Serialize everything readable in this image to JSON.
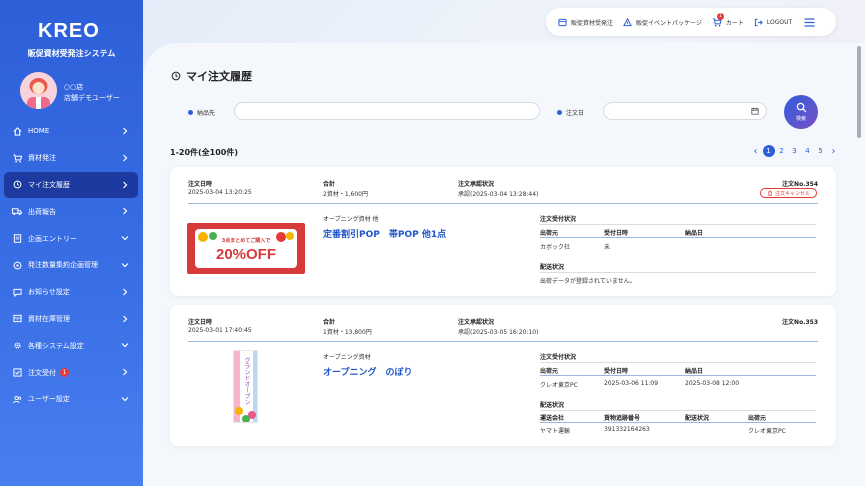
{
  "brand": {
    "logo": "KREO",
    "system_name": "販促資材受発注システム"
  },
  "user": {
    "line1": "○○店",
    "line2": "店舗デモユーザー"
  },
  "nav": [
    {
      "label": "HOME",
      "icon": "home-icon",
      "chev": "right"
    },
    {
      "label": "資材発注",
      "icon": "cart-icon",
      "chev": "right"
    },
    {
      "label": "マイ注文履歴",
      "icon": "history-icon",
      "chev": "right",
      "active": true
    },
    {
      "label": "出荷報告",
      "icon": "truck-icon",
      "chev": "right"
    },
    {
      "label": "企画エントリー",
      "icon": "document-icon",
      "chev": "down"
    },
    {
      "label": "発注数量集約企画管理",
      "icon": "settings-icon",
      "chev": "down"
    },
    {
      "label": "お知らせ設定",
      "icon": "message-icon",
      "chev": "right"
    },
    {
      "label": "資材在庫管理",
      "icon": "inventory-icon",
      "chev": "right"
    },
    {
      "label": "各種システム設定",
      "icon": "gear-icon",
      "chev": "down"
    },
    {
      "label": "注文受付",
      "icon": "check-icon",
      "chev": "right",
      "badge": "1"
    },
    {
      "label": "ユーザー設定",
      "icon": "users-icon",
      "chev": "down"
    }
  ],
  "topbar": {
    "material_order": "販促資材受発注",
    "event_package": "販促イベントパッケージ",
    "cart": "カート",
    "cart_badge": "1",
    "logout": "LOGOUT"
  },
  "page_title": "マイ注文履歴",
  "filters": {
    "delivery_label": "納品先",
    "delivery_value": "",
    "order_date_label": "注文日",
    "order_date_value": "",
    "search_label": "検索"
  },
  "result_count": "1-20件(全100件)",
  "pagination": {
    "prev": "‹",
    "pages": [
      "1",
      "2",
      "3",
      "4",
      "5"
    ],
    "current": "1",
    "next": "›"
  },
  "orders": [
    {
      "hdr_date": "注文日時",
      "date": "2025-03-04 13:20:25",
      "hdr_total": "合計",
      "total": "2資材・1,600円",
      "hdr_approval": "注文承認状況",
      "approval": "承認(2025-03-04 13:28:44)",
      "order_no": "注文No.354",
      "cancel_label": "注文キャンセル",
      "category": "オープニング資材 他",
      "product": "定番割引POP　帯POP 他1点",
      "banner_line1": "3点まとめてご購入で",
      "banner_line2": "20%OFF",
      "accept_title": "注文受付状況",
      "accept_cols": [
        "出荷元",
        "受付日時",
        "納品日"
      ],
      "accept_vals": [
        "カボック社",
        "未",
        ""
      ],
      "ship_title": "配送状況",
      "ship_empty": "出荷データが登録されていません。"
    },
    {
      "hdr_date": "注文日時",
      "date": "2025-03-01 17:40:45",
      "hdr_total": "合計",
      "total": "1資材・13,800円",
      "hdr_approval": "注文承認状況",
      "approval": "承認(2025-03-05 16:20:10)",
      "order_no": "注文No.353",
      "category": "オープニング資材",
      "product": "オープニング　のぼり",
      "nobori_text": "グランドオープン",
      "accept_title": "注文受付状況",
      "accept_cols": [
        "出荷元",
        "受付日時",
        "納品日"
      ],
      "accept_vals": [
        "クレオ東京PC",
        "2025-03-06 11:09",
        "2025-03-08 12:00"
      ],
      "ship_title": "配送状況",
      "ship_cols": [
        "運送会社",
        "貨物追跡番号",
        "配送状況",
        "出荷元"
      ],
      "ship_vals": [
        "ヤマト運輸",
        "391332164263",
        "",
        "クレオ東京PC"
      ]
    }
  ],
  "colors": {
    "primary": "#2d5fd9",
    "active_nav": "#1c3aa0",
    "link": "#1f56c8",
    "danger": "#e53935"
  }
}
